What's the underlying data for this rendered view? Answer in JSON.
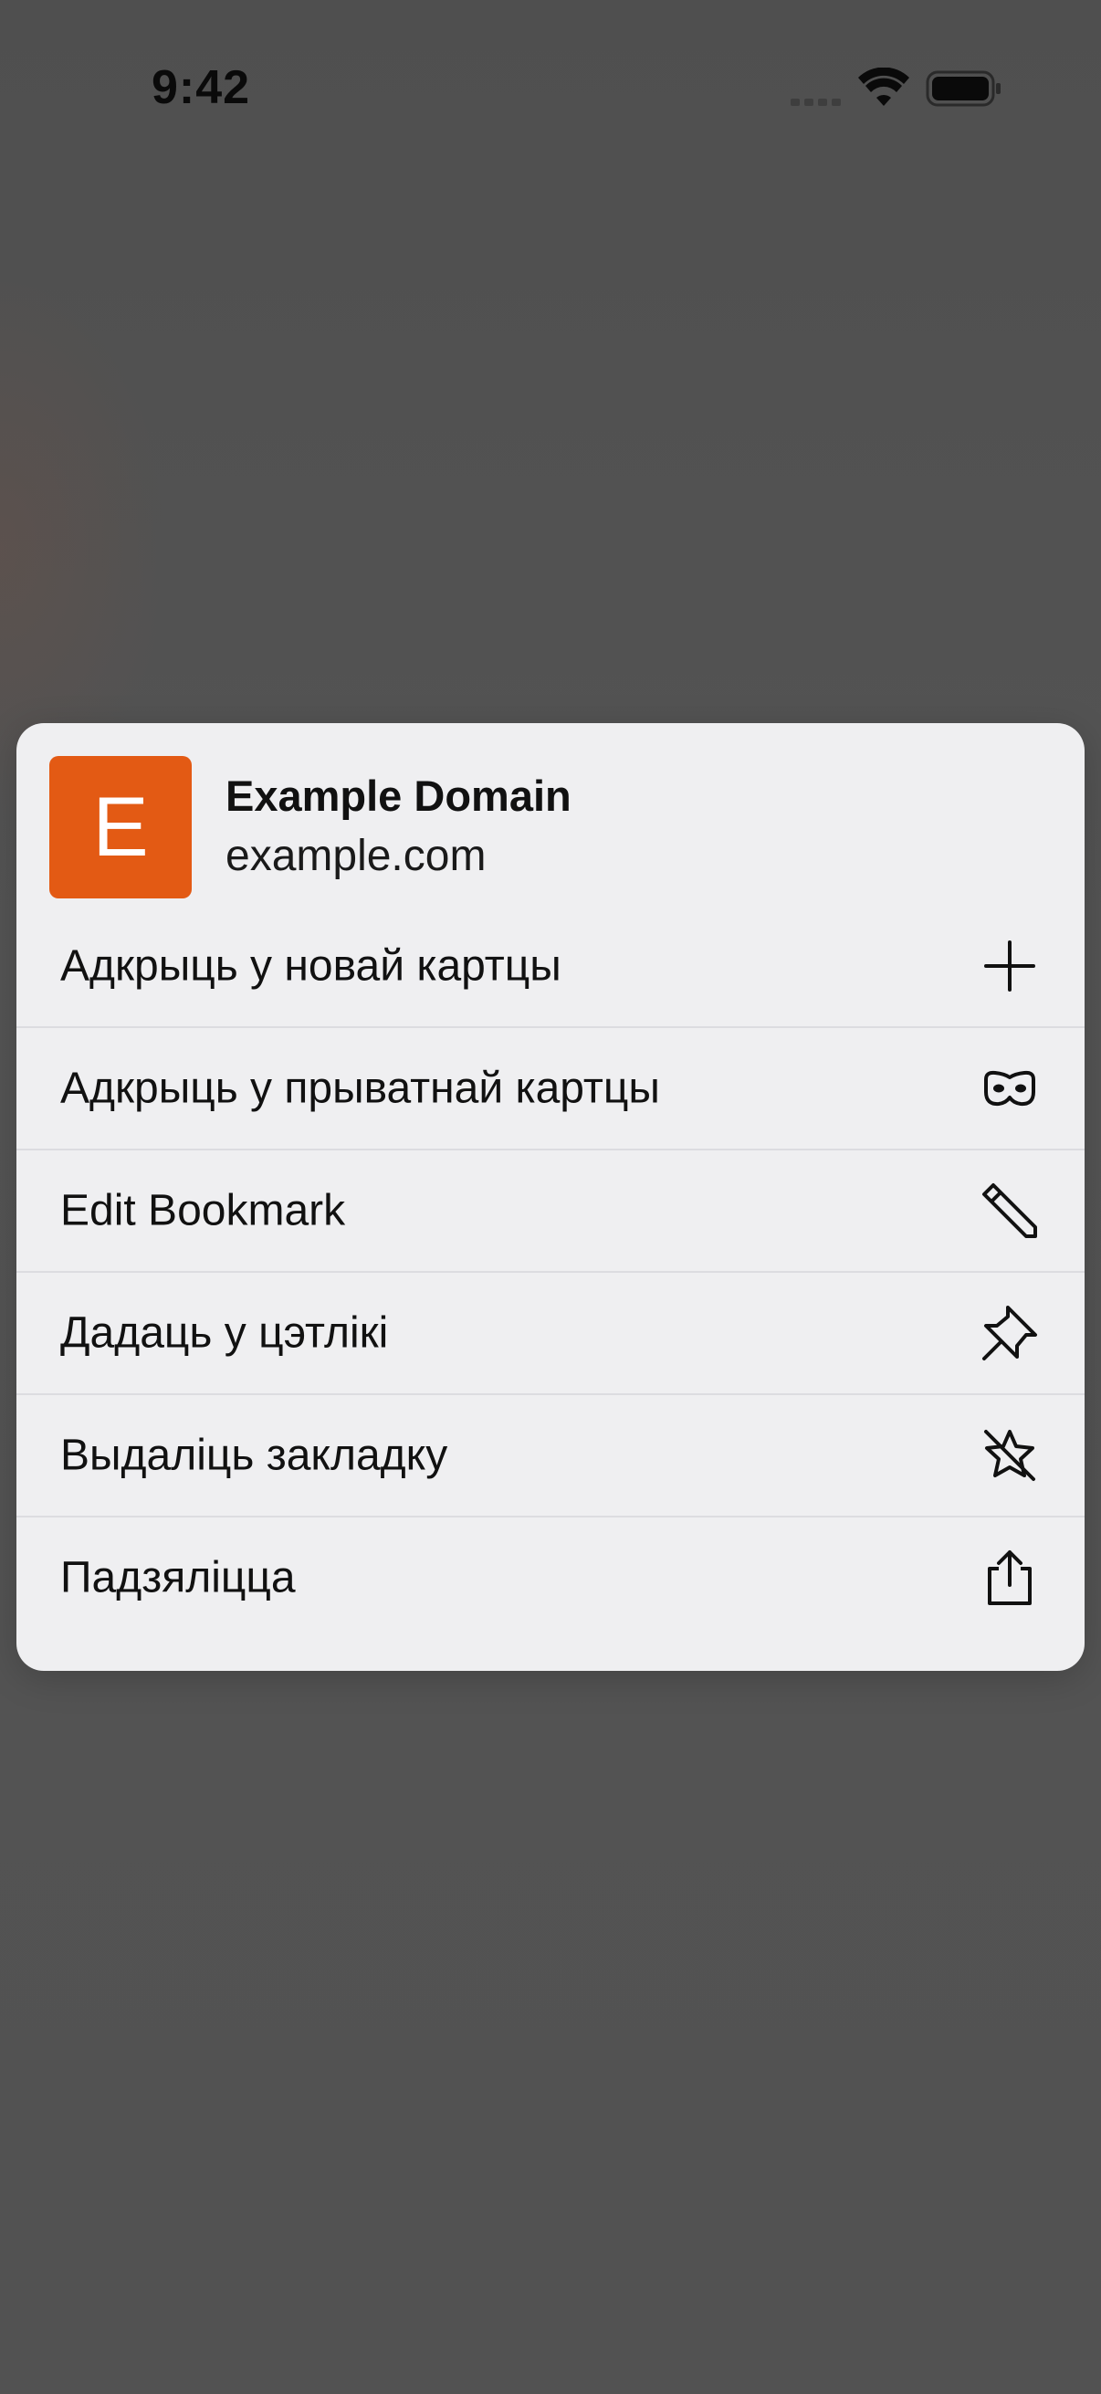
{
  "status_bar": {
    "time": "9:42"
  },
  "context_menu": {
    "site": {
      "icon_letter": "E",
      "icon_color": "#E35A14",
      "title": "Example Domain",
      "url": "example.com"
    },
    "items": [
      {
        "label": "Адкрыць у новай картцы",
        "icon": "plus-icon"
      },
      {
        "label": "Адкрыць у прыватнай картцы",
        "icon": "private-mask-icon"
      },
      {
        "label": "Edit Bookmark",
        "icon": "pencil-icon"
      },
      {
        "label": "Дадаць у цэтлікі",
        "icon": "pin-icon"
      },
      {
        "label": "Выдаліць закладку",
        "icon": "star-slash-icon"
      },
      {
        "label": "Падзяліцца",
        "icon": "share-icon"
      }
    ]
  }
}
